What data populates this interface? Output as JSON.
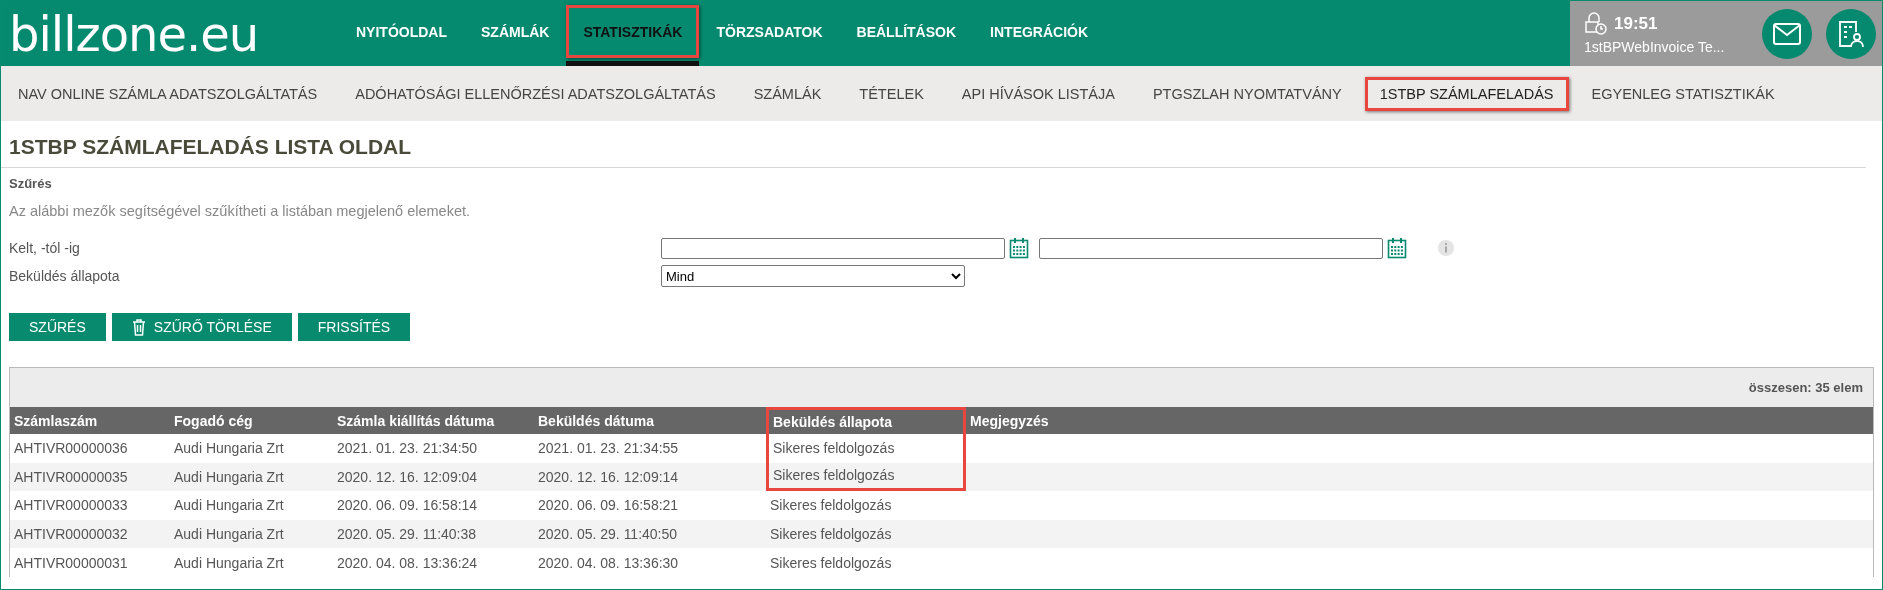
{
  "header": {
    "logo": "billzone.eu",
    "time": "19:51",
    "user": "1stBPWebInvoice Te..."
  },
  "nav": [
    {
      "label": "NYITÓOLDAL",
      "selected": false,
      "highlighted": false
    },
    {
      "label": "SZÁMLÁK",
      "selected": false,
      "highlighted": false
    },
    {
      "label": "STATISZTIKÁK",
      "selected": true,
      "highlighted": true
    },
    {
      "label": "TÖRZSADATOK",
      "selected": false,
      "highlighted": false
    },
    {
      "label": "BEÁLLÍTÁSOK",
      "selected": false,
      "highlighted": false
    },
    {
      "label": "INTEGRÁCIÓK",
      "selected": false,
      "highlighted": false
    }
  ],
  "subnav": [
    {
      "label": "NAV ONLINE SZÁMLA ADATSZOLGÁLTATÁS",
      "highlighted": false
    },
    {
      "label": "ADÓHATÓSÁGI ELLENŐRZÉSI ADATSZOLGÁLTATÁS",
      "highlighted": false
    },
    {
      "label": "SZÁMLÁK",
      "highlighted": false
    },
    {
      "label": "TÉTELEK",
      "highlighted": false
    },
    {
      "label": "API HÍVÁSOK LISTÁJA",
      "highlighted": false
    },
    {
      "label": "PTGSZLAH NYOMTATVÁNY",
      "highlighted": false
    },
    {
      "label": "1STBP SZÁMLAFELADÁS",
      "highlighted": true
    },
    {
      "label": "EGYENLEG STATISZTIKÁK",
      "highlighted": false
    }
  ],
  "page_title": "1STBP SZÁMLAFELADÁS LISTA OLDAL",
  "filter": {
    "title": "Szűrés",
    "description": "Az alábbi mezők segítségével szűkítheti a listában megjelenő elemeket.",
    "date_label": "Kelt, -tól -ig",
    "status_label": "Beküldés állapota",
    "status_value": "Mind",
    "buttons": [
      {
        "label": "SZŰRÉS",
        "kind": "plain"
      },
      {
        "label": "SZŰRŐ TÖRLÉSE",
        "kind": "trash"
      },
      {
        "label": "FRISSÍTÉS",
        "kind": "plain"
      }
    ]
  },
  "table": {
    "total": "összesen: 35 elem",
    "columns": [
      {
        "label": "Számlaszám",
        "highlighted": false
      },
      {
        "label": "Fogadó cég",
        "highlighted": false
      },
      {
        "label": "Számla kiállítás dátuma",
        "highlighted": false
      },
      {
        "label": "Beküldés dátuma",
        "highlighted": false
      },
      {
        "label": "Beküldés állapota",
        "highlighted": true
      },
      {
        "label": "Megjegyzés",
        "highlighted": false
      }
    ],
    "rows": [
      {
        "cells": [
          "AHTIVR00000036",
          "Audi Hungaria Zrt",
          "2021. 01. 23. 21:34:50",
          "2021. 01. 23. 21:34:55",
          "Sikeres feldolgozás"
        ],
        "highlighted": true
      },
      {
        "cells": [
          "AHTIVR00000035",
          "Audi Hungaria Zrt",
          "2020. 12. 16. 12:09:04",
          "2020. 12. 16. 12:09:14",
          "Sikeres feldolgozás"
        ],
        "highlighted": true
      },
      {
        "cells": [
          "AHTIVR00000033",
          "Audi Hungaria Zrt",
          "2020. 06. 09. 16:58:14",
          "2020. 06. 09. 16:58:21",
          "Sikeres feldolgozás"
        ],
        "highlighted": false
      },
      {
        "cells": [
          "AHTIVR00000032",
          "Audi Hungaria Zrt",
          "2020. 05. 29. 11:40:38",
          "2020. 05. 29. 11:40:50",
          "Sikeres feldolgozás"
        ],
        "highlighted": false
      },
      {
        "cells": [
          "AHTIVR00000031",
          "Audi Hungaria Zrt",
          "2020. 04. 08. 13:36:24",
          "2020. 04. 08. 13:36:30",
          "Sikeres feldolgozás"
        ],
        "highlighted": false
      }
    ]
  }
}
